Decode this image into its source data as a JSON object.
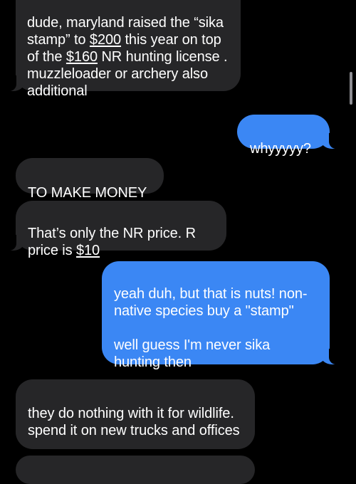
{
  "messages": [
    {
      "direction": "incoming",
      "parts": [
        {
          "text": "dude, maryland raised the “sika stamp” to "
        },
        {
          "text": "$200",
          "link": true
        },
        {
          "text": " this year on top of the "
        },
        {
          "text": "$160",
          "link": true
        },
        {
          "text": " NR hunting license . muzzleloader or archery also additional"
        }
      ]
    },
    {
      "direction": "outgoing",
      "text": "whyyyyy?"
    },
    {
      "direction": "incoming",
      "text": "TO MAKE MONEY"
    },
    {
      "direction": "incoming",
      "parts": [
        {
          "text": "That’s only the NR price. R price is "
        },
        {
          "text": "$10",
          "link": true
        }
      ]
    },
    {
      "direction": "outgoing",
      "text": "yeah duh, but that is nuts! non-native species buy a \"stamp\"\n\nwell guess I'm never sika hunting then"
    },
    {
      "direction": "incoming",
      "text": "they do nothing with it for wildlife. spend it on new trucks and offices"
    }
  ],
  "colors": {
    "background": "#000000",
    "incoming_bubble": "#262628",
    "outgoing_bubble": "#3b87f4",
    "text": "#ffffff",
    "scrollbar": "#8e8e93"
  }
}
